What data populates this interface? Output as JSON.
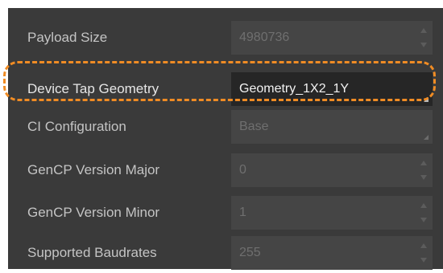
{
  "properties": [
    {
      "label": "Payload Size",
      "value": "4980736",
      "control": "spinner",
      "enabled": false
    },
    {
      "label": "Device Tap Geometry",
      "value": "Geometry_1X2_1Y",
      "control": "dropdown",
      "enabled": true,
      "highlighted": true
    },
    {
      "label": "CI Configuration",
      "value": "Base",
      "control": "dropdown",
      "enabled": false
    },
    {
      "label": "GenCP Version Major",
      "value": "0",
      "control": "spinner",
      "enabled": false
    },
    {
      "label": "GenCP Version Minor",
      "value": "1",
      "control": "spinner",
      "enabled": false
    },
    {
      "label": "Supported Baudrates",
      "value": "255",
      "control": "spinner",
      "enabled": false
    }
  ],
  "colors": {
    "panel_background": "#3a3a3a",
    "highlight_outline": "#f08c24",
    "active_field": "#262626"
  }
}
